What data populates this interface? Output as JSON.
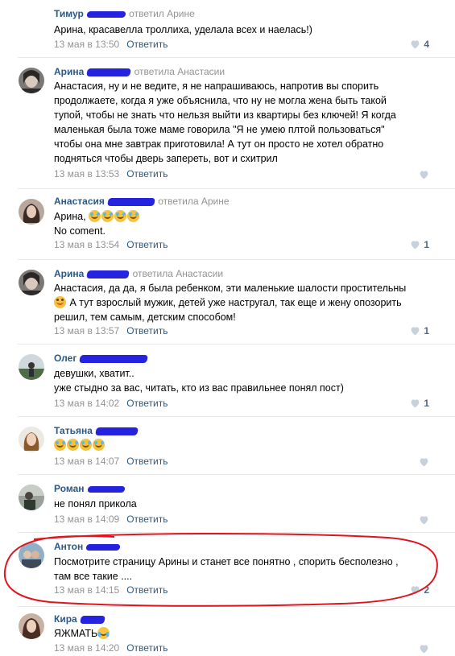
{
  "comments": [
    {
      "author": "Тимур",
      "action": "ответил Арине",
      "lines": [
        "Арина, красавелла троллиха, уделала всех и наелась!)"
      ],
      "date": "13 мая в 13:50",
      "reply": "Ответить",
      "likes": "4",
      "has_avatar": false
    },
    {
      "author": "Арина",
      "action": "ответила Анастасии",
      "lines": [
        "Анастасия, ну и не ведите, я не напрашиваюсь, напротив вы спорить",
        "продолжаете, когда я уже объяснила, что ну не могла жена быть такой",
        "тупой, чтобы не знать что нельзя выйти из квартиры без ключей! Я когда",
        "маленькая была тоже маме говорила \"Я не умею плтой пользоваться\"",
        "чтобы она мне завтрак приготовила! А тут он просто не хотел обратно",
        "подняться чтобы дверь запереть, вот и схитрил"
      ],
      "date": "13 мая в 13:53",
      "reply": "Ответить",
      "likes": ""
    },
    {
      "author": "Анастасия",
      "action": "ответила Арине",
      "lines": [
        "Арина,",
        "No coment."
      ],
      "date": "13 мая в 13:54",
      "reply": "Ответить",
      "likes": "1"
    },
    {
      "author": "Арина",
      "action": "ответила Анастасии",
      "lines": [
        "Анастасия, да да, я была ребенком, эти маленькие шалости простительны",
        "А тут взрослый мужик, детей уже настругал, так еще и жену опозорить",
        "решил, тем самым, детским способом!"
      ],
      "date": "13 мая в 13:57",
      "reply": "Ответить",
      "likes": "1"
    },
    {
      "author": "Олег",
      "action": "",
      "lines": [
        "девушки, хватит..",
        "уже стыдно за вас, читать, кто из вас правильнее понял пост)"
      ],
      "date": "13 мая в 14:02",
      "reply": "Ответить",
      "likes": "1"
    },
    {
      "author": "Татьяна",
      "action": "",
      "lines": [
        ""
      ],
      "date": "13 мая в 14:07",
      "reply": "Ответить",
      "likes": ""
    },
    {
      "author": "Роман",
      "action": "",
      "lines": [
        "не понял прикола"
      ],
      "date": "13 мая в 14:09",
      "reply": "Ответить",
      "likes": ""
    },
    {
      "author": "Антон",
      "action": "",
      "lines": [
        "Посмотрите страницу Арины и станет все понятно , спорить бесполезно ,",
        "там все такие ...."
      ],
      "date": "13 мая в 14:15",
      "reply": "Ответить",
      "likes": "2"
    },
    {
      "author": "Кира",
      "action": "",
      "lines": [
        "ЯЖМАТЬ"
      ],
      "date": "13 мая в 14:20",
      "reply": "Ответить",
      "likes": ""
    }
  ],
  "colors": {
    "author": "#2a5885",
    "meta": "#939393",
    "redacted": "#2623e0",
    "highlight_circle": "#e0141e"
  },
  "icons": [
    "heart-icon",
    "laughing-emoji",
    "crying-laugh-emoji",
    "smile-emoji"
  ]
}
